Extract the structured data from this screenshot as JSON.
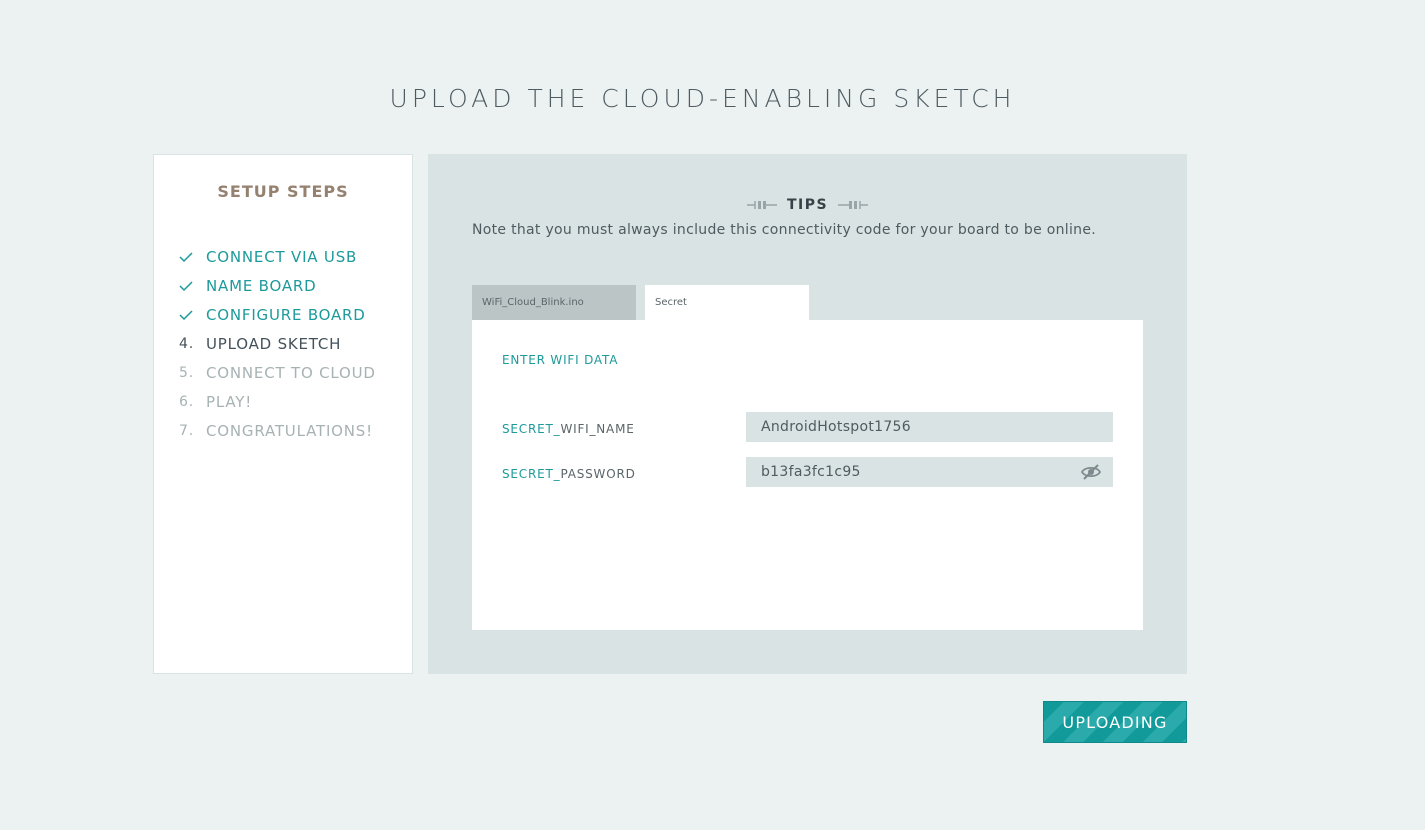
{
  "page": {
    "title": "UPLOAD THE CLOUD-ENABLING SKETCH"
  },
  "sidebar": {
    "title": "SETUP STEPS",
    "steps": [
      {
        "marker": "",
        "label": "CONNECT VIA USB",
        "state": "done"
      },
      {
        "marker": "",
        "label": "NAME BOARD",
        "state": "done"
      },
      {
        "marker": "",
        "label": "CONFIGURE BOARD",
        "state": "done"
      },
      {
        "marker": "4.",
        "label": "UPLOAD SKETCH",
        "state": "current"
      },
      {
        "marker": "5.",
        "label": "CONNECT TO CLOUD",
        "state": "pending"
      },
      {
        "marker": "6.",
        "label": "PLAY!",
        "state": "pending"
      },
      {
        "marker": "7.",
        "label": "CONGRATULATIONS!",
        "state": "pending"
      }
    ]
  },
  "tips": {
    "label": "TIPS",
    "text": "Note that you must always include this connectivity code for your board to be online."
  },
  "tabs": [
    {
      "label": "WiFi_Cloud_Blink.ino"
    },
    {
      "label": "Secret"
    }
  ],
  "secret": {
    "heading": "ENTER WIFI DATA",
    "wifi_name": {
      "prefix": "SECRET_",
      "rest": "WIFI_NAME",
      "value": "AndroidHotspot1756"
    },
    "password": {
      "prefix": "SECRET_",
      "rest": "PASSWORD",
      "value": "b13fa3fc1c95"
    }
  },
  "upload_button": {
    "label": "UPLOADING"
  },
  "colors": {
    "accent": "#1d9a9b",
    "sidebar_title": "#95816f",
    "background": "#ecf1f1",
    "panel": "#dae3e3"
  },
  "icons": [
    "check-icon",
    "plug-icon",
    "eye-slash-icon"
  ]
}
